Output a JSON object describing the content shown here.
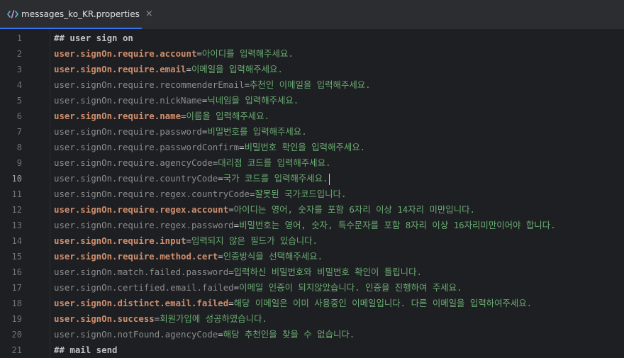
{
  "tab": {
    "filename": "messages_ko_KR.properties",
    "close_glyph": "×",
    "icon": "properties-file-icon"
  },
  "colors": {
    "tab_accent": "#3574f0",
    "key_highlight": "#cf8e6d",
    "key_default": "#8c8c8c",
    "value": "#6aab73"
  },
  "editor": {
    "current_line": 10,
    "lines": [
      {
        "num": "1",
        "type": "comment",
        "text": "## user sign on"
      },
      {
        "num": "2",
        "type": "prop",
        "strong": true,
        "key": "user.signOn.require.account",
        "value": "아이디를 입력해주세요."
      },
      {
        "num": "3",
        "type": "prop",
        "strong": true,
        "key": "user.signOn.require.email",
        "value": "이메일을 입력해주세요."
      },
      {
        "num": "4",
        "type": "prop",
        "strong": false,
        "key": "user.signOn.require.recommenderEmail",
        "value": "추천인 이메일을 입력해주세요."
      },
      {
        "num": "5",
        "type": "prop",
        "strong": false,
        "key": "user.signOn.require.nickName",
        "value": "닉네임을 입력해주세요."
      },
      {
        "num": "6",
        "type": "prop",
        "strong": true,
        "key": "user.signOn.require.name",
        "value": "이름을 입력해주세요."
      },
      {
        "num": "7",
        "type": "prop",
        "strong": false,
        "key": "user.signOn.require.password",
        "value": "비밀번호를 입력해주세요."
      },
      {
        "num": "8",
        "type": "prop",
        "strong": false,
        "key": "user.signOn.require.passwordConfirm",
        "value": "비밀번호 확인을 입력해주세요."
      },
      {
        "num": "9",
        "type": "prop",
        "strong": false,
        "key": "user.signOn.require.agencyCode",
        "value": "대리점 코드를 입력해주세요."
      },
      {
        "num": "10",
        "type": "prop",
        "strong": false,
        "key": "user.signOn.require.countryCode",
        "value": "국가 코드를 입력해주세요."
      },
      {
        "num": "11",
        "type": "prop",
        "strong": false,
        "key": "user.signOn.require.regex.countryCode",
        "value": "잘못된 국가코드입니다."
      },
      {
        "num": "12",
        "type": "prop",
        "strong": true,
        "key": "user.signOn.require.regex.account",
        "value": "아이디는 영어, 숫자를 포함 6자리 이상 14자리 미만입니다."
      },
      {
        "num": "13",
        "type": "prop",
        "strong": false,
        "key": "user.signOn.require.regex.password",
        "value": "비밀번호는 영어, 숫자, 특수문자를 포함 8자리 이상 16자리미만이어야 합니다."
      },
      {
        "num": "14",
        "type": "prop",
        "strong": true,
        "key": "user.signOn.require.input",
        "value": "입력되지 않은 필드가 있습니다."
      },
      {
        "num": "15",
        "type": "prop",
        "strong": true,
        "key": "user.signOn.require.method.cert",
        "value": "인증방식을 선택해주세요."
      },
      {
        "num": "16",
        "type": "prop",
        "strong": false,
        "key": "user.signOn.match.failed.password",
        "value": "입력하신 비밀번호와 비밀번호 확인이 틀립니다."
      },
      {
        "num": "17",
        "type": "prop",
        "strong": false,
        "key": "user.signOn.certified.email.failed",
        "value": "이메일 인증이 되지않았습니다. 인증을 진행하여 주세요."
      },
      {
        "num": "18",
        "type": "prop",
        "strong": true,
        "key": "user.signOn.distinct.email.failed",
        "value": "해당 이메일은 이미 사용중인 이메일입니다. 다른 이메일을 입력하여주세요."
      },
      {
        "num": "19",
        "type": "prop",
        "strong": true,
        "key": "user.signOn.success",
        "value": "회원가입에 성공하였습니다."
      },
      {
        "num": "20",
        "type": "prop",
        "strong": false,
        "key": "user.signOn.notFound.agencyCode",
        "value": "해당 추천인을 찾을 수 없습니다."
      },
      {
        "num": "21",
        "type": "comment",
        "text": "## mail send"
      }
    ]
  }
}
